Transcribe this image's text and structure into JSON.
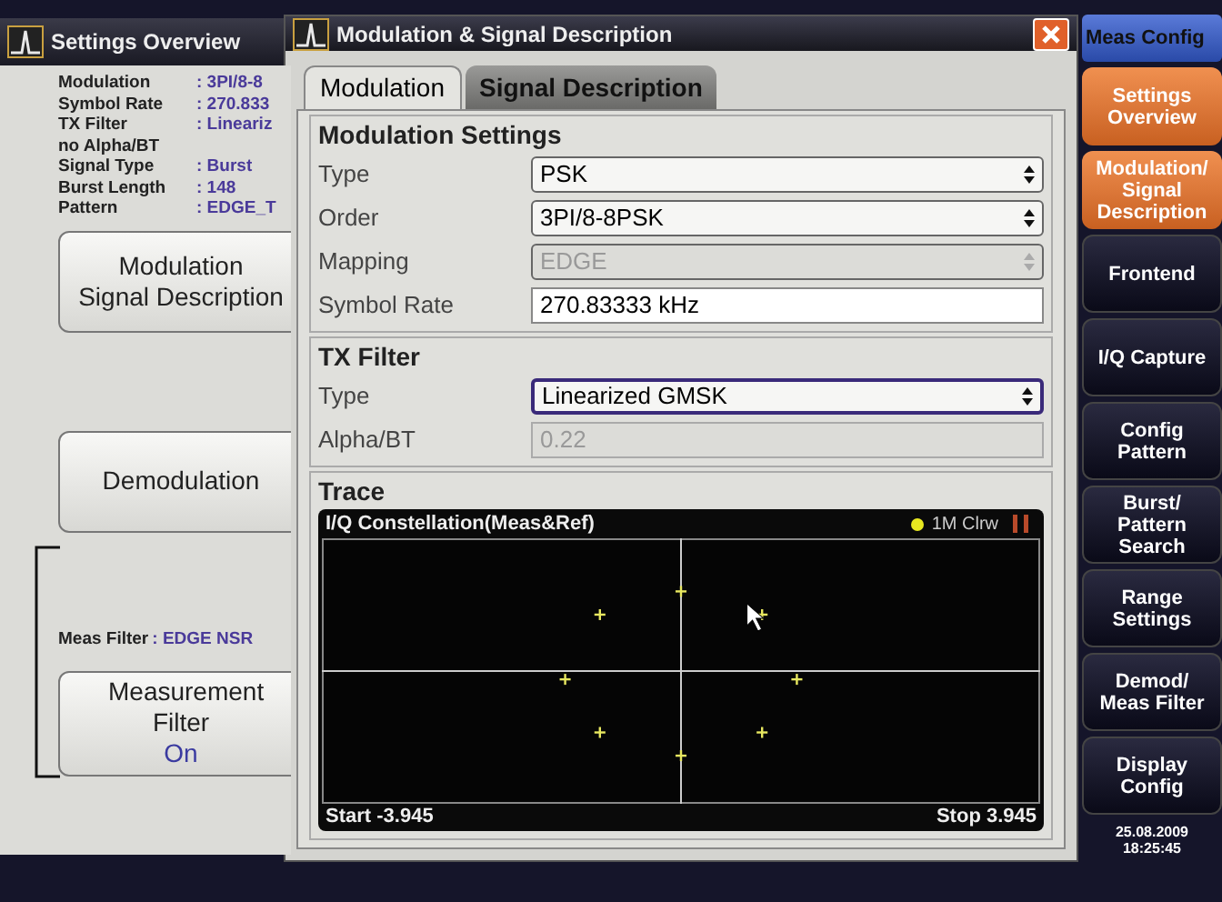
{
  "overview": {
    "title": "Settings Overview",
    "params": [
      {
        "label": "Modulation",
        "value": ": 3PI/8-8"
      },
      {
        "label": "Symbol Rate",
        "value": ": 270.833"
      },
      {
        "label": "TX Filter",
        "value": ": Lineariz"
      },
      {
        "label": "no Alpha/BT"
      },
      {
        "label": "Signal Type",
        "value": ": Burst"
      },
      {
        "label": "Burst Length",
        "value": ": 148"
      },
      {
        "label": "Pattern",
        "value": ": EDGE_T"
      }
    ],
    "modulation_button": {
      "lines": [
        "Modulation",
        "Signal Description"
      ]
    },
    "demodulation_button": {
      "label": "Demodulation"
    },
    "meas_filter": {
      "label": "Meas Filter",
      "value": ": EDGE NSR"
    },
    "measurement_filter_button": {
      "label": "Measurement Filter",
      "value": "On"
    }
  },
  "dialog": {
    "title": "Modulation & Signal Description",
    "tabs": [
      {
        "label": "Modulation",
        "selected": true
      },
      {
        "label": "Signal Description",
        "selected": false
      }
    ],
    "groups": [
      {
        "title": "Modulation Settings",
        "rows": [
          {
            "label": "Type",
            "kind": "select",
            "value": "PSK",
            "disabled": false,
            "focused": false
          },
          {
            "label": "Order",
            "kind": "select",
            "value": "3PI/8-8PSK",
            "disabled": false,
            "focused": false
          },
          {
            "label": "Mapping",
            "kind": "select",
            "value": "EDGE",
            "disabled": true,
            "focused": false
          },
          {
            "label": "Symbol Rate",
            "kind": "input",
            "value": "270.83333 kHz",
            "disabled": false,
            "focused": false
          }
        ]
      },
      {
        "title": "TX Filter",
        "rows": [
          {
            "label": "Type",
            "kind": "select",
            "value": "Linearized GMSK",
            "disabled": false,
            "focused": true
          },
          {
            "label": "Alpha/BT",
            "kind": "input",
            "value": "0.22",
            "disabled": true,
            "focused": false
          }
        ]
      }
    ],
    "trace": {
      "title": "Trace",
      "plot_title": "I/Q Constellation(Meas&Ref)",
      "legend": "1M Clrw",
      "start": "Start -3.945",
      "stop": "Stop 3.945"
    }
  },
  "sidebar": {
    "header": "Meas Config",
    "items": [
      {
        "lines": [
          "Settings",
          "Overview"
        ],
        "selected": true
      },
      {
        "lines": [
          "Modulation/",
          "Signal",
          "Description"
        ],
        "selected": true
      },
      {
        "lines": [
          "Frontend"
        ],
        "selected": false
      },
      {
        "lines": [
          "I/Q Capture"
        ],
        "selected": false
      },
      {
        "lines": [
          "Config",
          "Pattern"
        ],
        "selected": false
      },
      {
        "lines": [
          "Burst/",
          "Pattern",
          "Search"
        ],
        "selected": false
      },
      {
        "lines": [
          "Range",
          "Settings"
        ],
        "selected": false
      },
      {
        "lines": [
          "Demod/",
          "Meas Filter"
        ],
        "selected": false
      },
      {
        "lines": [
          "Display",
          "Config"
        ],
        "selected": false
      }
    ],
    "date": "25.08.2009",
    "time": "18:25:45"
  }
}
